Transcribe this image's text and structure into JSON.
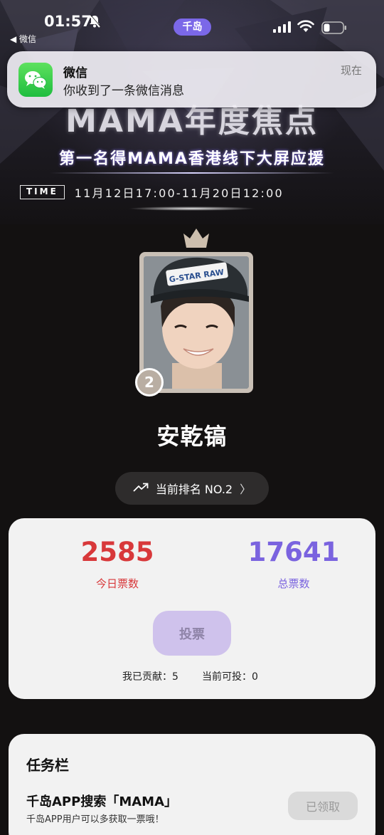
{
  "status_bar": {
    "time": "01:57",
    "app_badge": "千岛",
    "back_label": "◀ 微信"
  },
  "notification": {
    "app": "微信",
    "message": "你收到了一条微信消息",
    "time": "现在",
    "icon": "wechat-icon"
  },
  "banner": {
    "title": "MAMA年度焦点",
    "subtitle": "第一名得MAMA香港线下大屏应援",
    "time_tag": "TIME",
    "time_range": "11月12日17:00-11月20日12:00"
  },
  "profile": {
    "rank_number": "2",
    "name": "安乾镐",
    "rank_pill": "当前排名 NO.2",
    "rank_chevron": "〉",
    "cap_text": "G-STAR RAW"
  },
  "votes": {
    "today_count": "2585",
    "today_label": "今日票数",
    "total_count": "17641",
    "total_label": "总票数",
    "vote_button": "投票",
    "my_contribution": "我已贡献：5",
    "can_vote": "当前可投：0",
    "colors": {
      "today": "#d8383a",
      "total": "#7a63df"
    }
  },
  "tasks": {
    "title": "任务栏",
    "items": [
      {
        "name": "千岛APP搜索「MAMA」",
        "desc": "千岛APP用户可以多获取一票哦！",
        "button": "已领取"
      }
    ]
  }
}
